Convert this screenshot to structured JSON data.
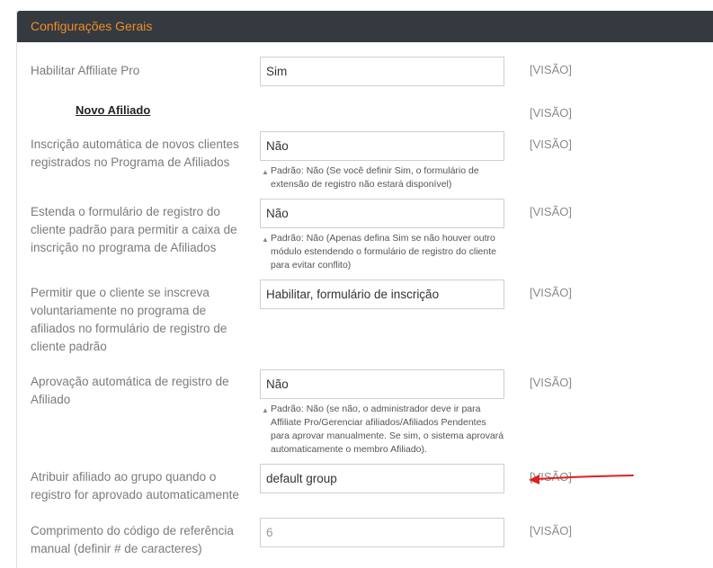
{
  "panel": {
    "title": "Configurações Gerais"
  },
  "settings": [
    {
      "label": "Habilitar Affiliate Pro",
      "value": "Sim",
      "view": "[VISÃO]"
    },
    {
      "section": "Novo Afiliado",
      "view": "[VISÃO]"
    },
    {
      "label": "Inscrição automática de novos clientes registrados no Programa de Afiliados",
      "value": "Não",
      "hint": "Padrão: Não (Se você definir Sim, o formulário de extensão de registro não estará disponível)",
      "view": "[VISÃO]"
    },
    {
      "label": "Estenda o formulário de registro do cliente padrão para permitir a caixa de inscrição no programa de Afiliados",
      "value": "Não",
      "hint": "Padrão: Não (Apenas defina Sim se não houver outro módulo estendendo o formulário de registro do cliente para evitar conflito)",
      "view": "[VISÃO]"
    },
    {
      "label": "Permitir que o cliente se inscreva voluntariamente no programa de afiliados no formulário de registro de cliente padrão",
      "value": "Habilitar, formulário de inscrição",
      "view": "[VISÃO]"
    },
    {
      "label": "Aprovação automática de registro de Afiliado",
      "value": "Não",
      "hint": "Padrão: Não (se não, o administrador deve ir para Affiliate Pro/Gerenciar afiliados/Afiliados Pendentes para aprovar manualmente. Se sim, o sistema aprovará automaticamente o membro Afiliado).",
      "view": "[VISÃO]"
    },
    {
      "label": "Atribuir afiliado ao grupo quando o registro for aprovado automaticamente",
      "value": "default group",
      "view": "[VISÃO]"
    },
    {
      "label": "Comprimento do código de referência manual (definir # de caracteres)",
      "value": "6",
      "view": "[VISÃO]"
    }
  ],
  "icons": {
    "hint_marker": "triangle-up-icon",
    "annotation": "red-arrow-annotation"
  },
  "colors": {
    "header_bg": "#353a40",
    "title": "#f28c28",
    "annotation": "#e02020"
  }
}
